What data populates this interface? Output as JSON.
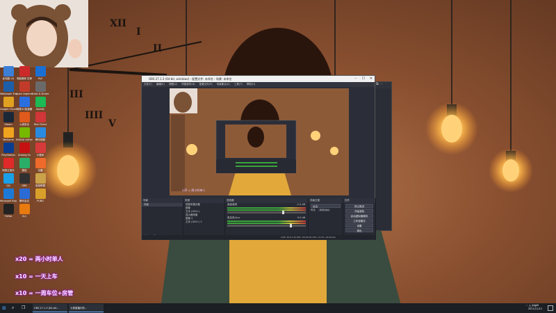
{
  "wallpaper": {
    "clock_numerals": [
      "XII",
      "I",
      "II",
      "III",
      "IIII",
      "V"
    ],
    "colors": {
      "bg": "#8a5030",
      "bulb": "#ffc45e",
      "shirt": "#e0a83a",
      "jacket": "#35453a"
    }
  },
  "desktop_icons": [
    {
      "label": "此电脑 (4)",
      "color": "#3b7fd6"
    },
    {
      "label": "电脑管家 拉伸",
      "color": "#cc2a2a"
    },
    {
      "label": "Hyll",
      "color": "#1a6fd4"
    },
    {
      "label": "Wallpaper Engine",
      "color": "#1d5ea8"
    },
    {
      "label": "Apex Legends",
      "color": "#c23b2a"
    },
    {
      "label": "Grab & Drawer",
      "color": "#6a6a6a"
    },
    {
      "label": "Google Chrome",
      "color": "#e0a020"
    },
    {
      "label": "网易UU加速器",
      "color": "#2a6ee0"
    },
    {
      "label": "Spotify",
      "color": "#1db954"
    },
    {
      "label": "Steam",
      "color": "#1b2838"
    },
    {
      "label": "火绒安全",
      "color": "#e05a1c"
    },
    {
      "label": "Riot Client",
      "color": "#d13639"
    },
    {
      "label": "WeGame",
      "color": "#f0a31e"
    },
    {
      "label": "NVIDIA GeForce",
      "color": "#76b900"
    },
    {
      "label": "腾讯视频",
      "color": "#2a8ae0"
    },
    {
      "label": "PlayStation",
      "color": "#0a3d8f"
    },
    {
      "label": "Among Us",
      "color": "#c51111"
    },
    {
      "label": "小程序",
      "color": "#d63a3a"
    },
    {
      "label": "网易云音乐",
      "color": "#e02a2a"
    },
    {
      "label": "微信",
      "color": "#2aae67"
    },
    {
      "label": "迅雷",
      "color": "#ee6a2a"
    },
    {
      "label": "QQ",
      "color": "#1aa0e8"
    },
    {
      "label": "OBS",
      "color": "#303030"
    },
    {
      "label": "英雄联盟",
      "color": "#caa24a"
    },
    {
      "label": "Microsoft Edge",
      "color": "#1c7ad6"
    },
    {
      "label": "腾讯会议",
      "color": "#2a6bd6"
    },
    {
      "label": "PUBG",
      "color": "#d8a02a"
    },
    {
      "label": "TikTok",
      "color": "#222222"
    },
    {
      "label": "VLC",
      "color": "#e87a10"
    }
  ],
  "obs": {
    "title": "OBS 27.1.3 (64-bit, windows) - 配置文件: 未命名 - 场景: 未命名",
    "menu": [
      "文件(F)",
      "编辑(E)",
      "视图(V)",
      "停靠部件(D)",
      "配置文件(P)",
      "场景集合(S)",
      "工具(T)",
      "帮助(H)"
    ],
    "docks": {
      "scenes": {
        "title": "场景",
        "items": [
          "场景"
        ]
      },
      "sources": {
        "title": "来源",
        "items": [
          "视频采集设备",
          "图像",
          "文本 (GDI+)",
          "显示器采集",
          "图像 2",
          "文本 (GDI+) 2"
        ]
      },
      "mixer": {
        "title": "混音器",
        "channels": [
          {
            "name": "桌面音频",
            "db": "-2.4 dB"
          },
          {
            "name": "麦克风/Aux",
            "db": "0.0 dB"
          }
        ]
      },
      "transitions": {
        "title": "场景过渡",
        "type": "淡出",
        "duration_label": "时长",
        "duration": "300 ms"
      },
      "controls": {
        "title": "控件",
        "buttons": [
          "停止推流",
          "开始录制",
          "启动虚拟摄像机",
          "工作室模式",
          "设置",
          "退出"
        ]
      }
    },
    "status": "LIVE: 00:01:15   REC: 00:00:00   CPU: 12.9%, 60.00 fps"
  },
  "overlay": {
    "promo_lines": [
      "x20 = 两小时单人",
      "x10 = 一天上车",
      "x10 = 一周车位+房管"
    ]
  },
  "taskbar": {
    "start_icon": "windows-icon",
    "search_icon": "search-icon",
    "items": [
      "OBS 27.1.3 (64-bit...",
      "七夜直播中的..."
    ],
    "time": "14:46",
    "date": "2021/11/12"
  }
}
